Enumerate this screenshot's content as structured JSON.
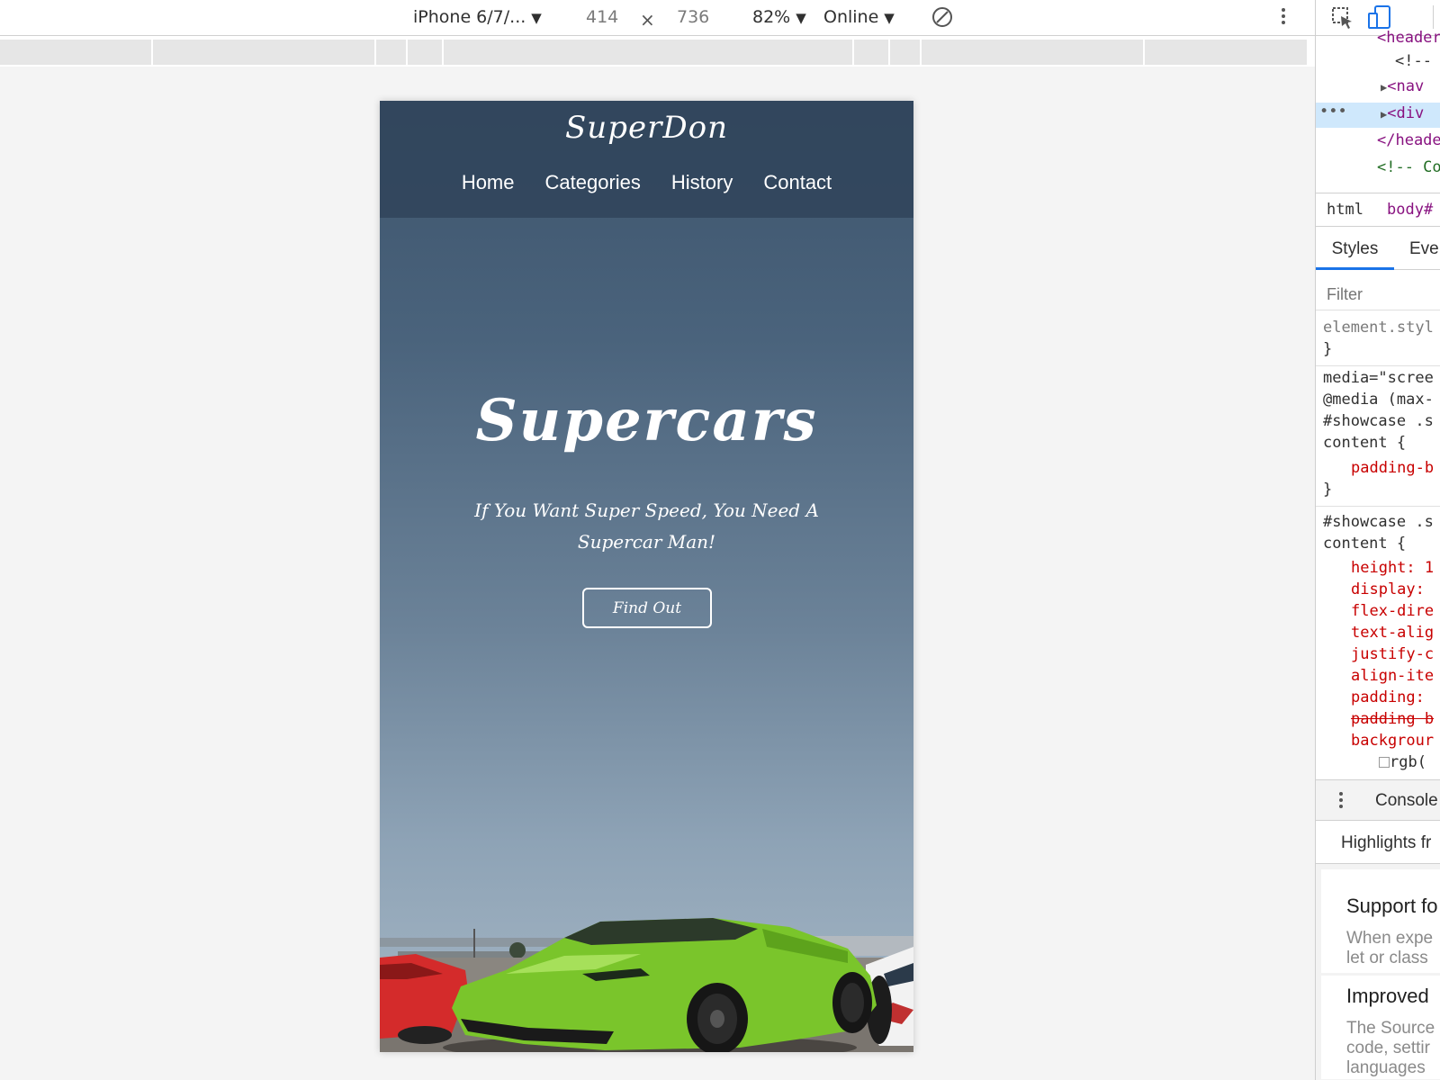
{
  "device_toolbar": {
    "device": "iPhone 6/7/...",
    "width": "414",
    "times": "×",
    "height": "736",
    "zoom": "82%",
    "throttling": "Online",
    "dropdown_arrow": "▼",
    "icons": [
      "rotate-icon",
      "kebab-menu-icon"
    ]
  },
  "site": {
    "logo": "SuperDon",
    "nav": [
      "Home",
      "Categories",
      "History",
      "Contact"
    ],
    "hero_title": "Supercars",
    "hero_subtitle": "If You Want Super Speed, You Need A Supercar Man!",
    "cta_label": "Find Out"
  },
  "devtools": {
    "toolbar_icons": [
      "inspect-element-icon",
      "device-mode-icon"
    ],
    "elements": {
      "line0": "<header",
      "line1": "<!--",
      "line2": "<nav",
      "line3": "<div",
      "line4": "</heade",
      "line5": "<!-- Co",
      "dots": "•••"
    },
    "breadcrumb": {
      "html": "html",
      "body": "body#"
    },
    "tabs": {
      "styles": "Styles",
      "event": "Eve"
    },
    "filter_placeholder": "Filter",
    "rules": {
      "r1": "element.styl",
      "r2": "}",
      "r3": "media=\"scree",
      "r4": "@media (max-",
      "r5": "#showcase .s",
      "r6": "content {",
      "r7": "padding-b",
      "r8": "}",
      "r9": "#showcase .s",
      "r10": "content {",
      "r11": "height: 1",
      "r12": "display:",
      "r13": "flex-dire",
      "r14": "text-alig",
      "r15": "justify-c",
      "r16": "align-ite",
      "r17": "padding:",
      "r18": "padding b",
      "r19": "backgrour",
      "r20": "rgb("
    },
    "drawer": {
      "console": "Console",
      "whats_new": "Highlights fr",
      "cards": [
        {
          "title": "Support fo",
          "line1": "When expe",
          "line2": "let or class"
        },
        {
          "title": "Improved",
          "line1": "The Source",
          "line2": "code, settir",
          "line3": "languages"
        }
      ]
    }
  },
  "colors": {
    "header_bg": "#30445a",
    "sky_top": "#3d546c",
    "sky_bottom": "#a6b7c5",
    "car_green": "#7ac52b",
    "devtools_accent": "#1a73e8",
    "tag_color": "#881280",
    "comment_color": "#236e25",
    "property_color": "#c80000"
  }
}
